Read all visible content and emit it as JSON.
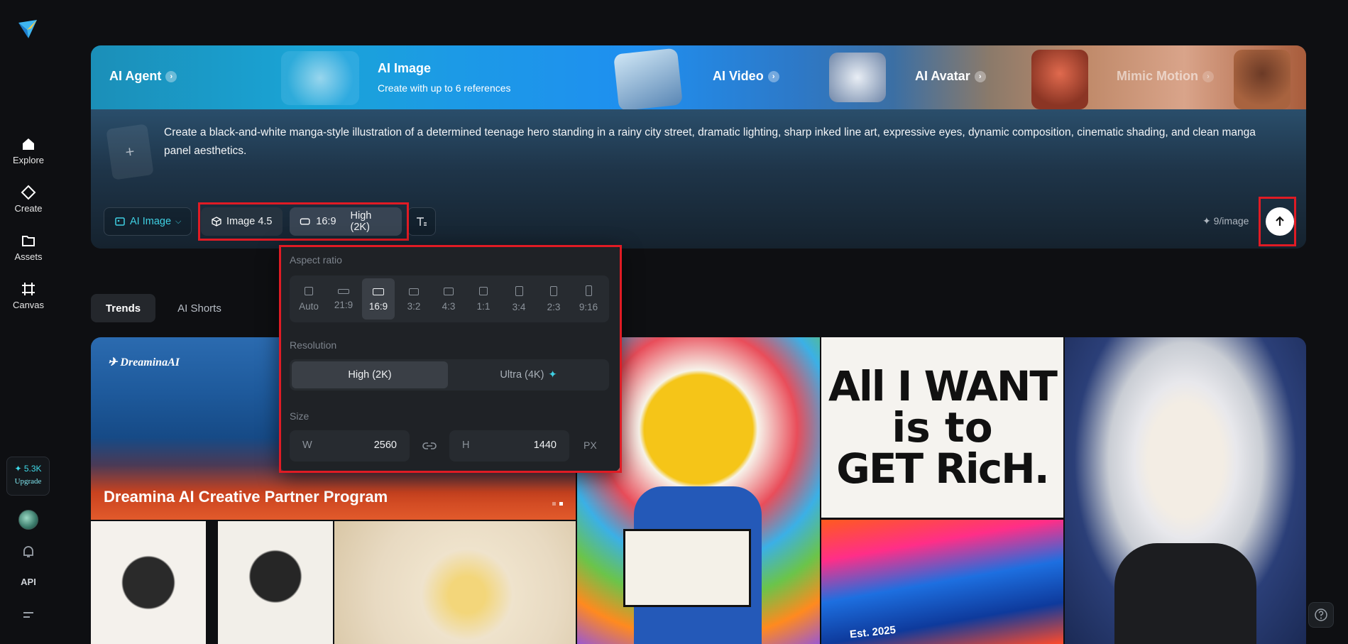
{
  "sidebar": {
    "items": [
      {
        "label": "Explore"
      },
      {
        "label": "Create"
      },
      {
        "label": "Assets"
      },
      {
        "label": "Canvas"
      }
    ],
    "credits": "✦ 5.3K",
    "upgrade_label": "Upgrade",
    "api_label": "API"
  },
  "hero": {
    "tabs": [
      {
        "label": "AI Agent"
      },
      {
        "label": "AI Image",
        "subtitle": "Create with up to 6 references"
      },
      {
        "label": "AI Video"
      },
      {
        "label": "AI Avatar"
      },
      {
        "label": "Mimic Motion"
      }
    ],
    "prompt": "Create a black-and-white manga-style illustration of a determined teenage hero standing in a rainy city street, dramatic lighting, sharp inked line art, expressive eyes, dynamic composition, cinematic shading, and clean manga panel aesthetics.",
    "upload_symbol": "+",
    "mode_label": "AI Image",
    "model_label": "Image 4.5",
    "ratio_label": "16:9",
    "resolution_label": "High (2K)",
    "price_label": "✦ 9/image"
  },
  "trends": {
    "tabs": [
      {
        "label": "Trends"
      },
      {
        "label": "AI Shorts"
      }
    ]
  },
  "gallery": {
    "banner_logo": "✈ DreaminaAI",
    "banner_title": "Dreamina AI Creative Partner Program",
    "poster_text": [
      "All I WANT",
      "is to",
      "GET RicH."
    ],
    "est_text": "Est. 2025"
  },
  "dropdown": {
    "aspect_title": "Aspect ratio",
    "ratios": [
      "Auto",
      "21:9",
      "16:9",
      "3:2",
      "4:3",
      "1:1",
      "3:4",
      "2:3",
      "9:16"
    ],
    "selected_ratio": "16:9",
    "resolution_title": "Resolution",
    "resolutions": [
      "High (2K)",
      "Ultra (4K)"
    ],
    "selected_resolution": "High (2K)",
    "size_title": "Size",
    "width_label": "W",
    "width_value": "2560",
    "height_label": "H",
    "height_value": "1440",
    "unit": "PX"
  },
  "colors": {
    "accent": "#3fd0e3",
    "highlight": "#e01b24",
    "background": "#0e0f12"
  }
}
